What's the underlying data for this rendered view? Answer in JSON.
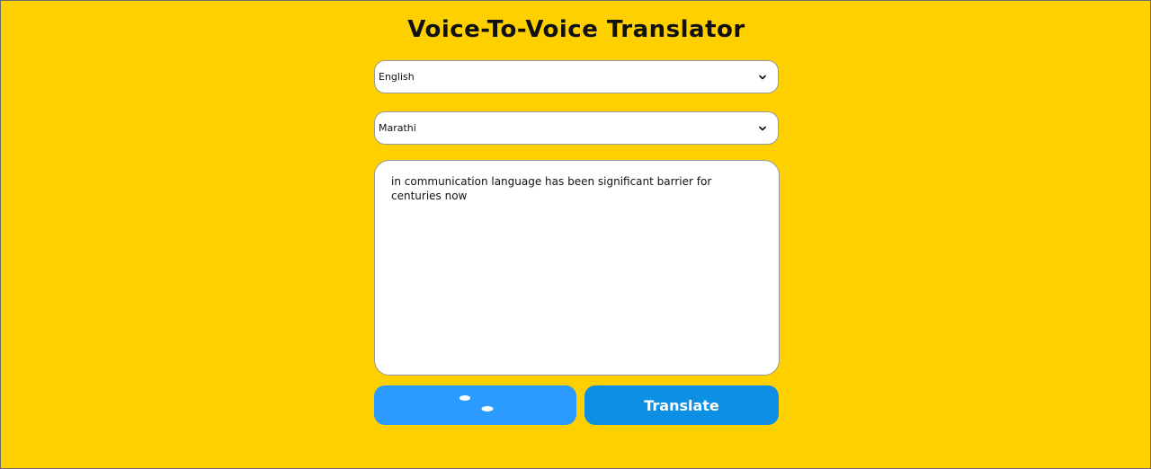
{
  "app": {
    "title": "Voice-To-Voice Translator"
  },
  "source_language": {
    "selected": "English",
    "icon": "chevron-down-icon"
  },
  "target_language": {
    "selected": "Marathi",
    "icon": "chevron-down-icon"
  },
  "input_text": {
    "value": "in communication language has been significant barrier for centuries now"
  },
  "buttons": {
    "record_icon": "loading-dots-icon",
    "translate_label": "Translate"
  },
  "colors": {
    "background": "#ffd000",
    "record_button": "#2b9bff",
    "translate_button": "#0d8fe3"
  }
}
